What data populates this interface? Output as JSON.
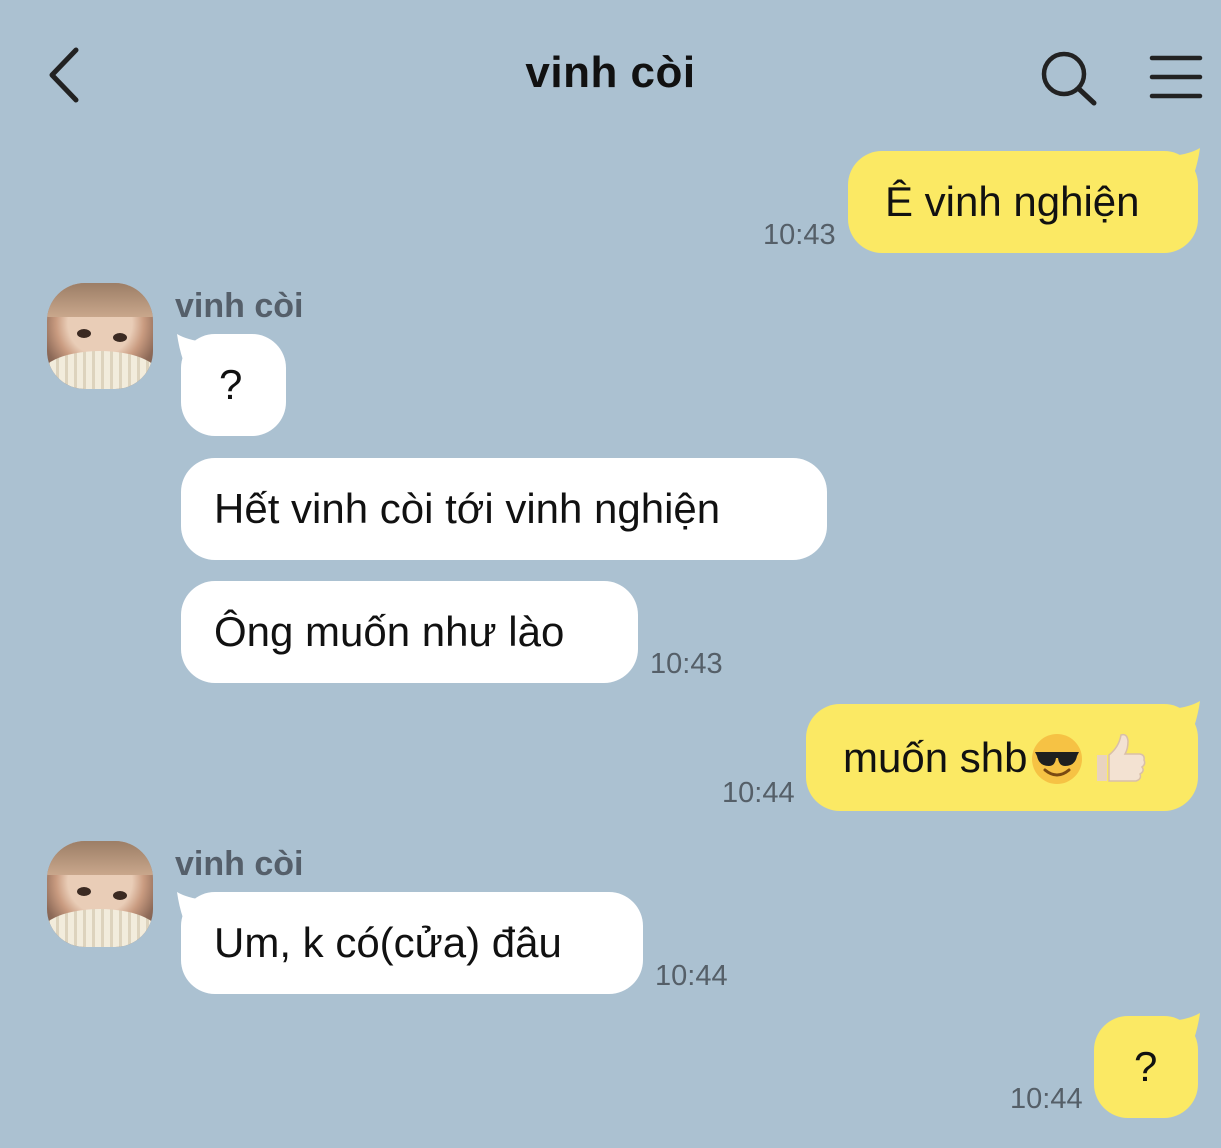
{
  "header": {
    "title": "vinh còi",
    "back_icon": "chevron-left-icon",
    "search_icon": "search-icon",
    "menu_icon": "hamburger-menu-icon"
  },
  "colors": {
    "background": "#abc1d1",
    "outgoing_bubble": "#fbe964",
    "incoming_bubble": "#ffffff"
  },
  "messages": [
    {
      "direction": "outgoing",
      "text": "Ê vinh nghiện",
      "time": "10:43"
    },
    {
      "direction": "incoming",
      "sender": "vinh còi",
      "text": "?"
    },
    {
      "direction": "incoming",
      "text": "Hết vinh còi tới vinh nghiện"
    },
    {
      "direction": "incoming",
      "text": "Ông muốn như lào",
      "time": "10:43"
    },
    {
      "direction": "outgoing",
      "text": "muốn shb",
      "emojis": [
        "smiling-face-with-sunglasses-emoji",
        "thumbs-up-emoji"
      ],
      "time": "10:44"
    },
    {
      "direction": "incoming",
      "sender": "vinh còi",
      "text": "Um, k có(cửa) đâu",
      "time": "10:44"
    },
    {
      "direction": "outgoing",
      "text": "?",
      "time": "10:44"
    }
  ]
}
